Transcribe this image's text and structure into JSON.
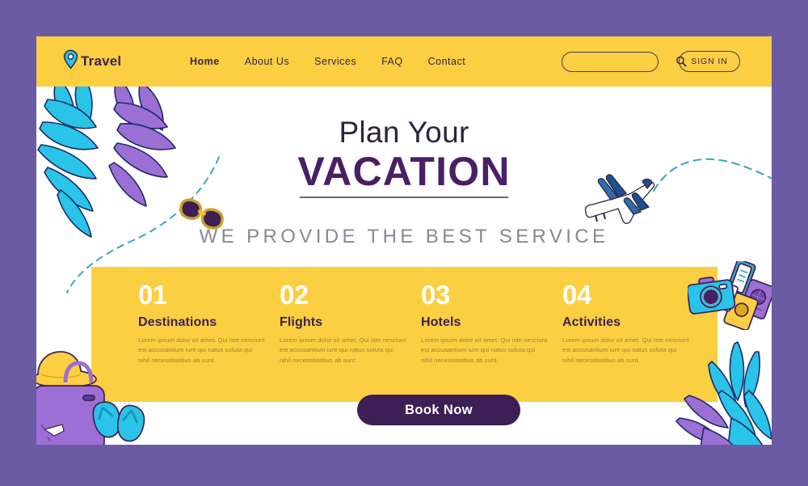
{
  "theme": {
    "page_background": "#6b5ba5",
    "card_background": "#ffffff",
    "accent_yellow": "#fbcf41",
    "accent_purple": "#3d1f56",
    "accent_cyan": "#29c4e8",
    "accent_violet": "#9b6fd4",
    "heading_dark": "#2c2340",
    "heading_purple": "#4a1f66",
    "muted_gray": "#8b8696",
    "body_on_yellow": "#9c8334"
  },
  "navbar": {
    "brand": {
      "label": "Travel",
      "icon": "location-pin-icon"
    },
    "links": [
      {
        "label": "Home",
        "active": true
      },
      {
        "label": "About Us",
        "active": false
      },
      {
        "label": "Services",
        "active": false
      },
      {
        "label": "FAQ",
        "active": false
      },
      {
        "label": "Contact",
        "active": false
      }
    ],
    "search": {
      "value": "",
      "placeholder": "",
      "icon": "search-icon"
    },
    "signin": {
      "label": "SIGN IN"
    }
  },
  "hero": {
    "line1": "Plan Your",
    "line2": "VACATION",
    "subtitle": "WE PROVIDE THE BEST SERVICE"
  },
  "features": [
    {
      "number": "01",
      "title": "Destinations",
      "body": "Lorem ipsum dolor sit amet. Qui iste nesciunt est accusantium iure qui natus soluta qui nihil necessitatibus ab sunt."
    },
    {
      "number": "02",
      "title": "Flights",
      "body": "Lorem ipsum dolor sit amet. Qui iste nesciunt est accusantium iure qui natus soluta qui nihil necessitatibus ab sunt."
    },
    {
      "number": "03",
      "title": "Hotels",
      "body": "Lorem ipsum dolor sit amet. Qui iste nesciunt est accusantium iure qui natus soluta qui nihil necessitatibus ab sunt."
    },
    {
      "number": "04",
      "title": "Activities",
      "body": "Lorem ipsum dolor sit amet. Qui iste nesciunt est accusantium iure qui natus soluta qui nihil necessitatibus ab sunt."
    }
  ],
  "cta": {
    "label": "Book Now"
  },
  "decorations": [
    {
      "name": "palm-leaves-top-left-illustration"
    },
    {
      "name": "dashed-route-path-left-illustration"
    },
    {
      "name": "sunglasses-illustration"
    },
    {
      "name": "airplane-illustration"
    },
    {
      "name": "dashed-flight-path-illustration"
    },
    {
      "name": "camera-and-passports-illustration"
    },
    {
      "name": "palm-leaves-bottom-right-illustration"
    },
    {
      "name": "suitcase-hat-flipflops-illustration"
    }
  ]
}
